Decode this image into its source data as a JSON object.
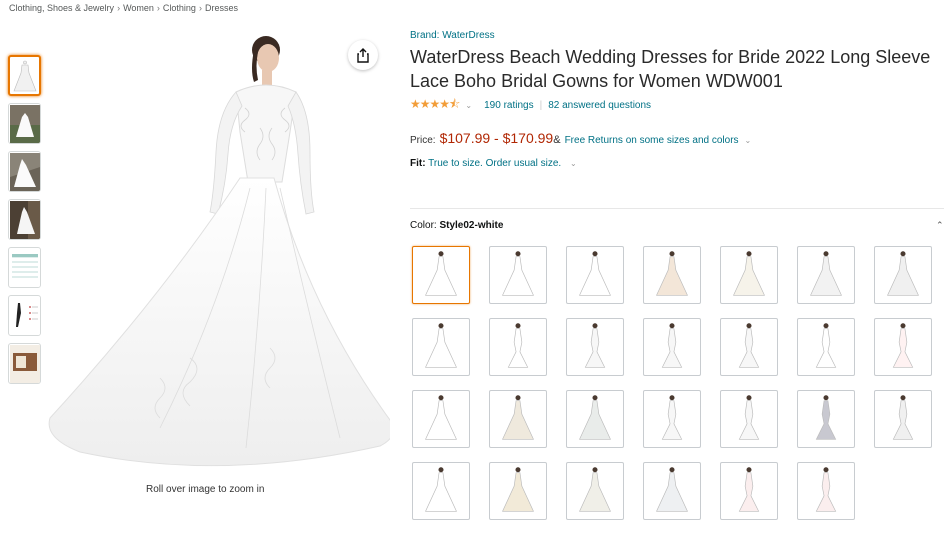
{
  "breadcrumb": [
    "Clothing, Shoes & Jewelry",
    "Women",
    "Clothing",
    "Dresses"
  ],
  "main": {
    "zoom_hint": "Roll over image to zoom in"
  },
  "product": {
    "brand": "Brand: WaterDress",
    "title": "WaterDress Beach Wedding Dresses for Bride 2022 Long Sleeve Lace Boho Bridal Gowns for Women WDW001",
    "stars": "★★★★⯪",
    "ratings": "190 ratings",
    "answered": "82 answered questions",
    "price_label": "Price:",
    "price_range": "$107.99 - $170.99",
    "price_amp": "&",
    "free_returns": "Free Returns on some sizes and colors",
    "fit_label": "Fit:",
    "fit_text": "True to size. Order usual size.",
    "color_label": "Color:",
    "color_value": "Style02-white"
  },
  "colors": {
    "accent": "#e77600",
    "link": "#007185",
    "price": "#b12704",
    "star": "#f29d38"
  },
  "thumbnail_count": 7,
  "swatch_count": 27
}
